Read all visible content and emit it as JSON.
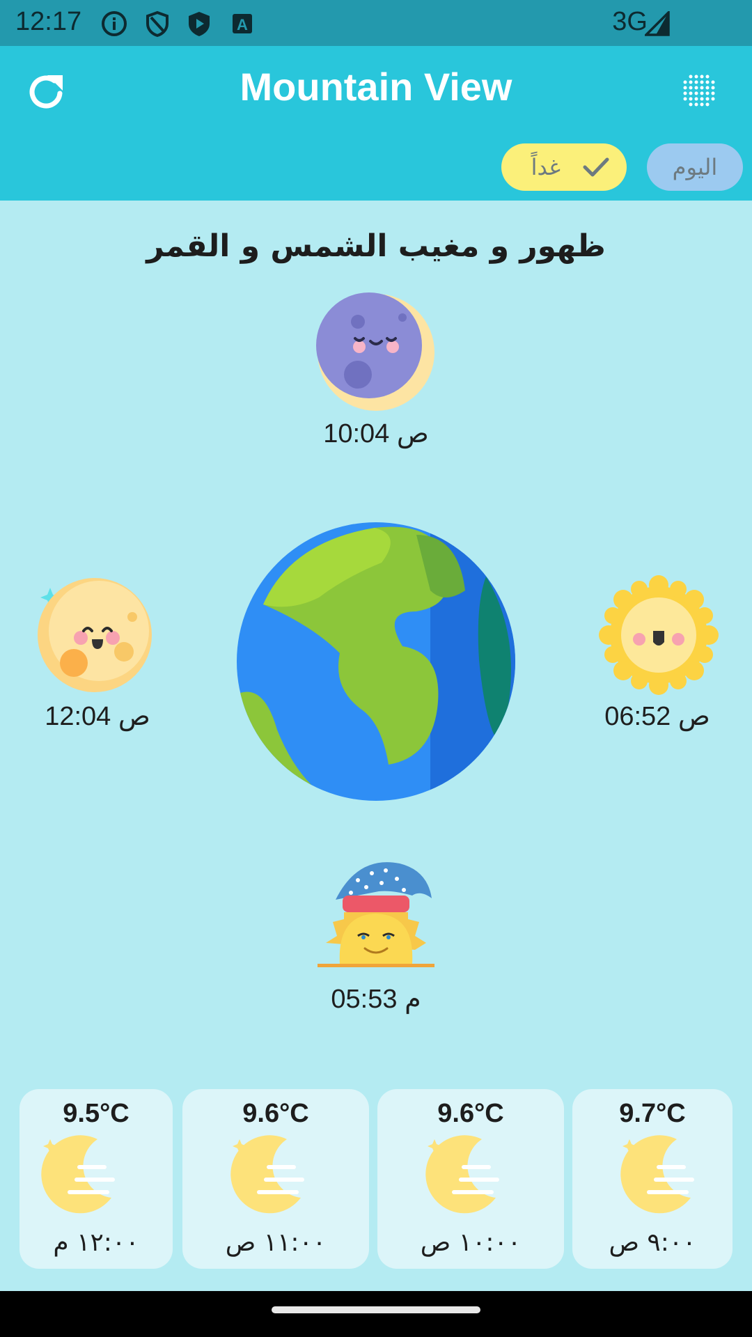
{
  "status_bar": {
    "time": "12:17",
    "network": "3G",
    "icons": [
      "info-icon",
      "shield-icon",
      "play-shield-icon",
      "text-a-icon",
      "signal-icon"
    ]
  },
  "app_bar": {
    "title": "Mountain View",
    "refresh_icon": "refresh-icon",
    "menu_icon": "dot-grid-icon",
    "bg_color": "#29c6db"
  },
  "day_tabs": {
    "tomorrow_label": "غداً",
    "today_label": "اليوم",
    "tomorrow_color": "#fbf07a",
    "today_color": "#9ccaf0"
  },
  "astronomy": {
    "title": "ظهور و مغيب الشمس و القمر",
    "moonrise_time": "10:04 ص",
    "moonset_time": "12:04 ص",
    "sunrise_time": "06:52 ص",
    "sunset_time": "05:53 م"
  },
  "forecast": [
    {
      "temp": "9.5°C",
      "time": "١٢:٠٠ م",
      "icon": "night-moon-icon"
    },
    {
      "temp": "9.6°C",
      "time": "١١:٠٠ ص",
      "icon": "night-moon-icon"
    },
    {
      "temp": "9.6°C",
      "time": "١٠:٠٠ ص",
      "icon": "night-moon-icon"
    },
    {
      "temp": "9.7°C",
      "time": "٩:٠٠ ص",
      "icon": "night-moon-icon"
    }
  ]
}
